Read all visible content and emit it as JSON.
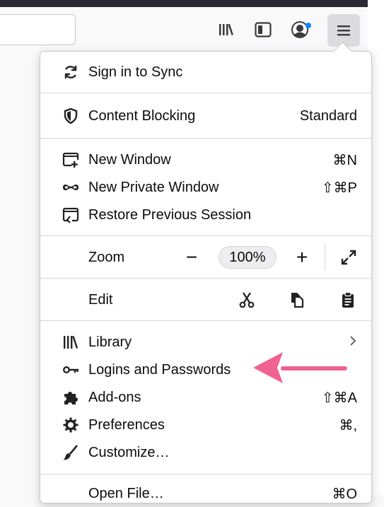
{
  "menu": {
    "sync": "Sign in to Sync",
    "content_blocking": "Content Blocking",
    "content_blocking_value": "Standard",
    "new_window": "New Window",
    "new_window_shortcut": "⌘N",
    "private_window": "New Private Window",
    "private_window_shortcut": "⇧⌘P",
    "restore_session": "Restore Previous Session",
    "zoom": "Zoom",
    "zoom_minus": "−",
    "zoom_level": "100%",
    "zoom_plus": "+",
    "edit": "Edit",
    "library": "Library",
    "logins": "Logins and Passwords",
    "addons": "Add-ons",
    "addons_shortcut": "⇧⌘A",
    "preferences": "Preferences",
    "preferences_shortcut": "⌘,",
    "customize": "Customize…",
    "open_file": "Open File…",
    "open_file_shortcut": "⌘O"
  },
  "icons": {
    "toolbar": [
      "library-icon",
      "sidebar-icon",
      "account-icon",
      "hamburger-menu-icon"
    ],
    "menu": [
      "sync-icon",
      "shield-icon",
      "new-window-icon",
      "private-mask-icon",
      "restore-session-icon",
      "expand-icon",
      "cut-icon",
      "copy-icon",
      "paste-icon",
      "library-icon",
      "key-icon",
      "puzzle-icon",
      "gear-icon",
      "brush-icon",
      "chevron-right-icon"
    ]
  },
  "colors": {
    "annotation_arrow": "#f06292",
    "account_badge": "#0a84ff"
  }
}
